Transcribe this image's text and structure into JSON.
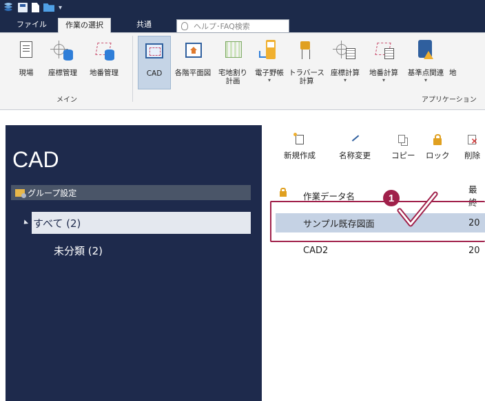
{
  "tabs": {
    "file": "ファイル",
    "work_select": "作業の選択",
    "common": "共通"
  },
  "help_search": {
    "placeholder": "ヘルプ･FAQ検索"
  },
  "ribbon": {
    "main_group_label": "メイン",
    "app_group_label": "アプリケーション",
    "main_buttons": [
      "現場",
      "座標管理",
      "地番管理"
    ],
    "app_buttons": [
      {
        "label": "CAD",
        "label2": ""
      },
      {
        "label": "各階平面図",
        "label2": ""
      },
      {
        "label": "宅地割り",
        "label2": "計画"
      },
      {
        "label": "電子野帳",
        "label2": "▾"
      },
      {
        "label": "トラバース",
        "label2": "計算"
      },
      {
        "label": "座標計算",
        "label2": "▾"
      },
      {
        "label": "地番計算",
        "label2": "▾"
      },
      {
        "label": "基準点関連",
        "label2": "▾"
      },
      {
        "label": "地",
        "label2": ""
      }
    ]
  },
  "left_panel": {
    "title": "CAD",
    "group_header": "グループ設定",
    "tree_all": "すべて (2)",
    "tree_child": "未分類 (2)"
  },
  "actions": [
    "新規作成",
    "名称変更",
    "コピー",
    "ロック",
    "削除"
  ],
  "table": {
    "col_name": "作業データ名",
    "col_date": "最終",
    "rows": [
      {
        "name": "サンプル既存図面",
        "date": "20"
      },
      {
        "name": "CAD2",
        "date": "20"
      }
    ]
  },
  "annotation": {
    "badge": "1"
  },
  "colors": {
    "dark_navy": "#1e2a4c",
    "title_bar": "#1c2a4a",
    "selected_row": "#c5d2e4",
    "highlight": "#a0204a"
  }
}
